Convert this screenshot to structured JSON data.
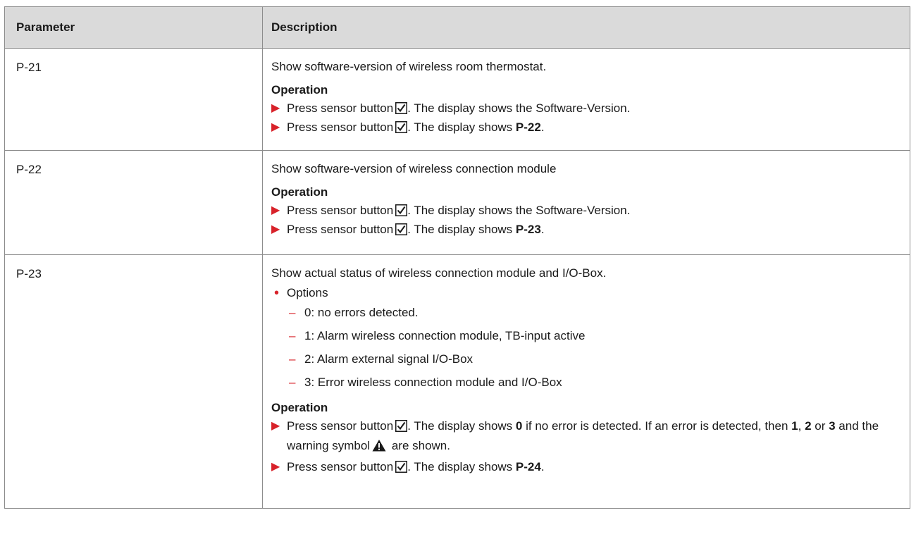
{
  "table": {
    "headers": {
      "parameter": "Parameter",
      "description": "Description"
    },
    "rows": [
      {
        "param": "P-21",
        "intro": "Show software-version of wireless room thermostat.",
        "op_heading": "Operation",
        "steps": [
          {
            "pre": "Press sensor button",
            "post": ". The display shows the Software-Version."
          },
          {
            "pre": "Press sensor button",
            "post": ". The display shows ",
            "bold": "P-22",
            "end": "."
          }
        ]
      },
      {
        "param": "P-22",
        "intro": "Show software-version of wireless connection module",
        "op_heading": "Operation",
        "steps": [
          {
            "pre": "Press sensor button",
            "post": ". The display shows the Software-Version."
          },
          {
            "pre": "Press sensor button",
            "post": ". The display shows ",
            "bold": "P-23",
            "end": "."
          }
        ]
      },
      {
        "param": "P-23",
        "intro": "Show actual status of wireless connection module and I/O-Box.",
        "bullet": "Options",
        "options": [
          "0: no errors detected.",
          "1: Alarm wireless connection module, TB-input active",
          "2: Alarm external signal I/O-Box",
          "3: Error wireless connection module and I/O-Box"
        ],
        "op_heading": "Operation",
        "step1": {
          "pre": "Press sensor button",
          "a": ". The display shows ",
          "b0": "0",
          "c": " if no error is detected. If an error is detected, then ",
          "b1": "1",
          "d": ", ",
          "b2": "2",
          "e": " or ",
          "b3": "3",
          "f": " and the warning symbol",
          "g": " are shown."
        },
        "step2": {
          "pre": "Press sensor button",
          "post": ". The display shows ",
          "bold": "P-24",
          "end": "."
        }
      }
    ]
  },
  "icons": {
    "checkbox": "checkbox-checked-icon",
    "arrow": "triangle-right-icon",
    "warning": "warning-triangle-icon",
    "accent_color": "#d8222a"
  }
}
